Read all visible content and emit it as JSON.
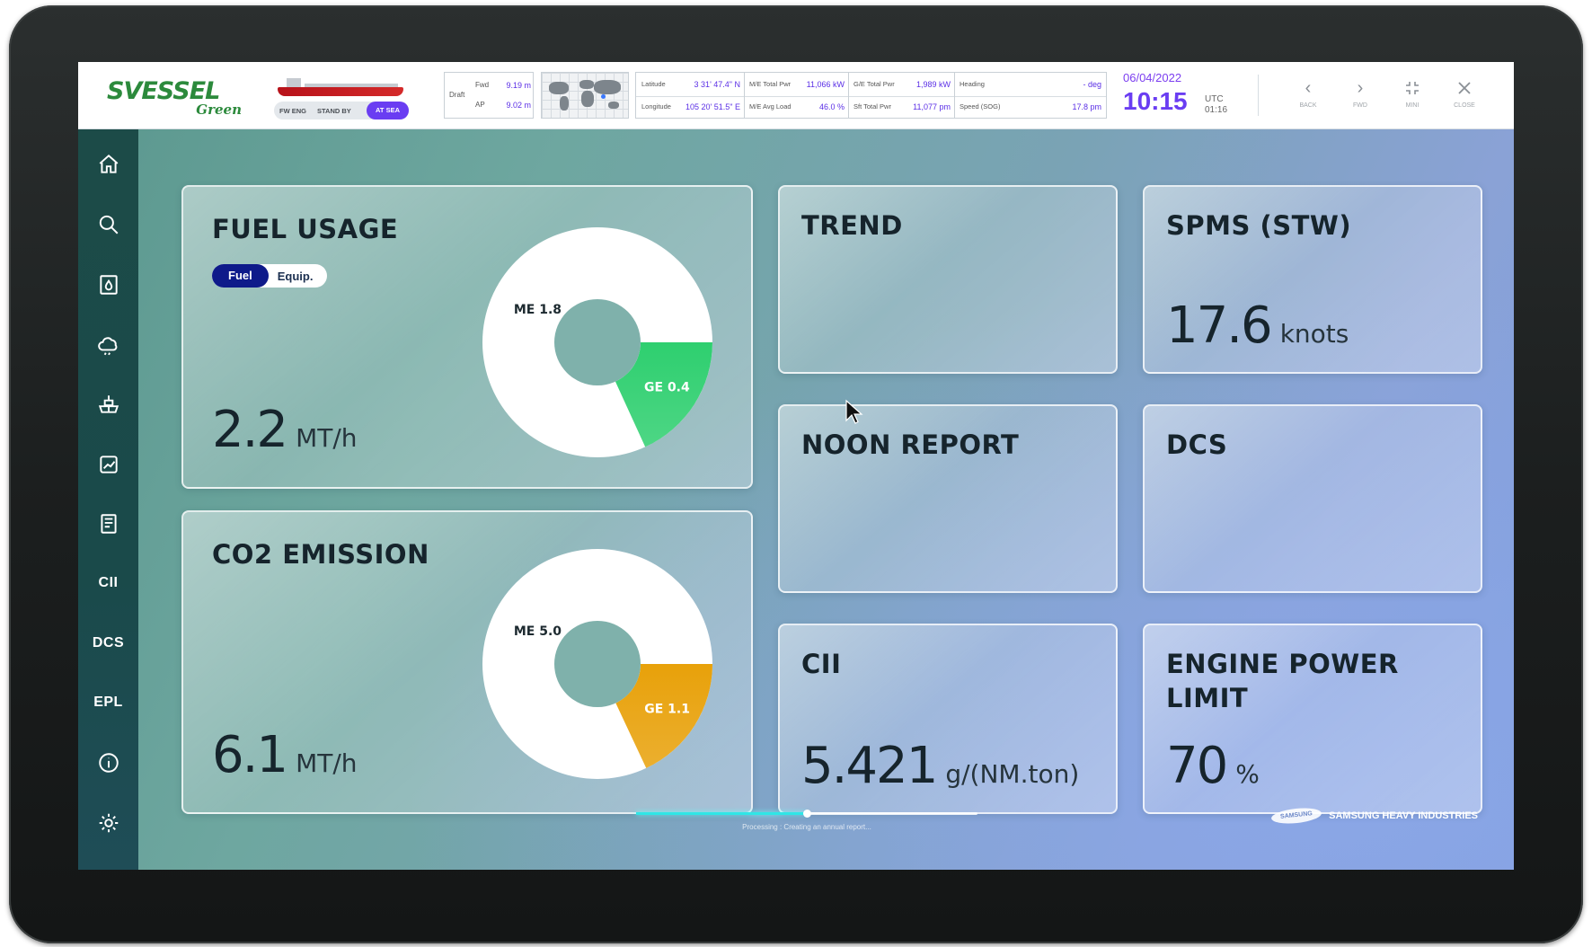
{
  "header": {
    "logo_main": "SVESSEL",
    "logo_sub": "Green",
    "modes": [
      "FW ENG",
      "STAND BY",
      "AT SEA"
    ],
    "draft": {
      "label": "Draft",
      "fwd_label": "Fwd",
      "fwd_value": "9.19 m",
      "ap_label": "AP",
      "ap_value": "9.02 m"
    },
    "position": {
      "lat_label": "Latitude",
      "lat_value": "3  31' 47.4\" N",
      "lon_label": "Longitude",
      "lon_value": "105  20' 51.5\" E",
      "me_pwr_label": "M/E Total Pwr",
      "me_pwr_value": "11,066 kW",
      "me_load_label": "M/E Avg Load",
      "me_load_value": "46.0 %",
      "ge_pwr_label": "G/E Total Pwr",
      "ge_pwr_value": "1,989 kW",
      "sft_pwr_label": "Sft Total Pwr",
      "sft_pwr_value": "11,077 pm",
      "heading_label": "Heading",
      "heading_value": "- deg",
      "speed_label": "Speed (SOG)",
      "speed_value": "17.8 pm"
    },
    "date": "06/04/2022",
    "time": "10:15",
    "utc_label": "UTC",
    "utc_time": "01:16",
    "nav": [
      {
        "label": "BACK",
        "icon": "chevron-left-icon"
      },
      {
        "label": "FWD",
        "icon": "chevron-right-icon"
      },
      {
        "label": "MINI",
        "icon": "minimize-icon"
      },
      {
        "label": "CLOSE",
        "icon": "close-icon"
      }
    ]
  },
  "sidebar": {
    "icons": [
      "home-icon",
      "search-icon",
      "fuel-icon",
      "co2-cloud-icon",
      "ship-icon",
      "report-chart-icon",
      "document-icon",
      "info-icon",
      "settings-icon"
    ],
    "text_items": [
      "CII",
      "DCS",
      "EPL"
    ]
  },
  "cards": {
    "fuel": {
      "title": "FUEL USAGE",
      "toggle_on": "Fuel",
      "toggle_off": "Equip.",
      "value": "2.2",
      "unit": "MT/h",
      "chart_data": {
        "type": "pie",
        "categories": [
          "ME",
          "GE"
        ],
        "values": [
          1.8,
          0.4
        ],
        "labels": [
          "ME 1.8",
          "GE 0.4"
        ],
        "colors": [
          "#ffffff",
          "#2ecf6f"
        ]
      }
    },
    "co2": {
      "title": "CO2 EMISSION",
      "value": "6.1",
      "unit": "MT/h",
      "chart_data": {
        "type": "pie",
        "categories": [
          "ME",
          "GE"
        ],
        "values": [
          5.0,
          1.1
        ],
        "labels": [
          "ME 5.0",
          "GE 1.1"
        ],
        "colors": [
          "#ffffff",
          "#e8a10a"
        ]
      }
    },
    "trend": {
      "title": "TREND"
    },
    "spms": {
      "title": "SPMS (STW)",
      "value": "17.6",
      "unit": "knots"
    },
    "noon": {
      "title": "NOON REPORT"
    },
    "dcs": {
      "title": "DCS"
    },
    "cii": {
      "title": "CII",
      "value": "5.421",
      "unit": "g/(NM.ton)"
    },
    "epl": {
      "title_line1": "ENGINE POWER",
      "title_line2": "LIMIT",
      "value": "70",
      "unit": "%"
    }
  },
  "footer": {
    "progress_fraction": 0.5,
    "progress_text": "Processing : Creating an annual report...",
    "brand_oval": "SAMSUNG",
    "brand": "SAMSUNG HEAVY INDUSTRIES"
  }
}
